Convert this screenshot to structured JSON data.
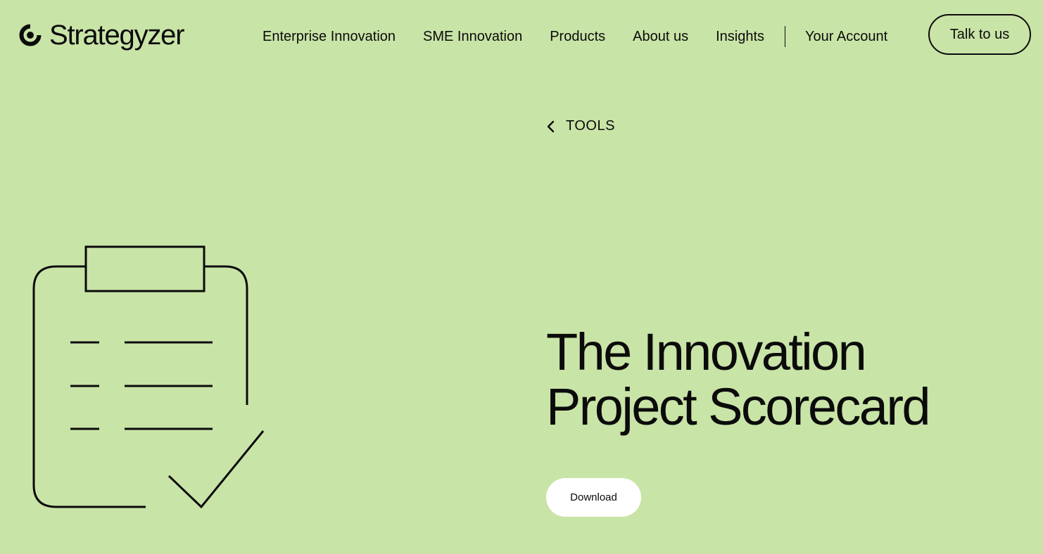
{
  "brand": {
    "name": "Strategyzer"
  },
  "nav": {
    "items": [
      {
        "label": "Enterprise Innovation",
        "name": "nav-enterprise-innovation"
      },
      {
        "label": "SME Innovation",
        "name": "nav-sme-innovation"
      },
      {
        "label": "Products",
        "name": "nav-products"
      },
      {
        "label": "About us",
        "name": "nav-about-us"
      },
      {
        "label": "Insights",
        "name": "nav-insights"
      }
    ],
    "account_label": "Your Account",
    "cta_label": "Talk to us"
  },
  "breadcrumb": {
    "back_label": "TOOLS",
    "icon": "chevron-left-icon"
  },
  "hero": {
    "title_line1": "The Innovation",
    "title_line2": "Project Scorecard",
    "download_label": "Download",
    "illustration": "clipboard-check-icon"
  },
  "colors": {
    "background": "#c9e4a7",
    "text": "#0b0b0b",
    "button_bg": "#ffffff"
  }
}
